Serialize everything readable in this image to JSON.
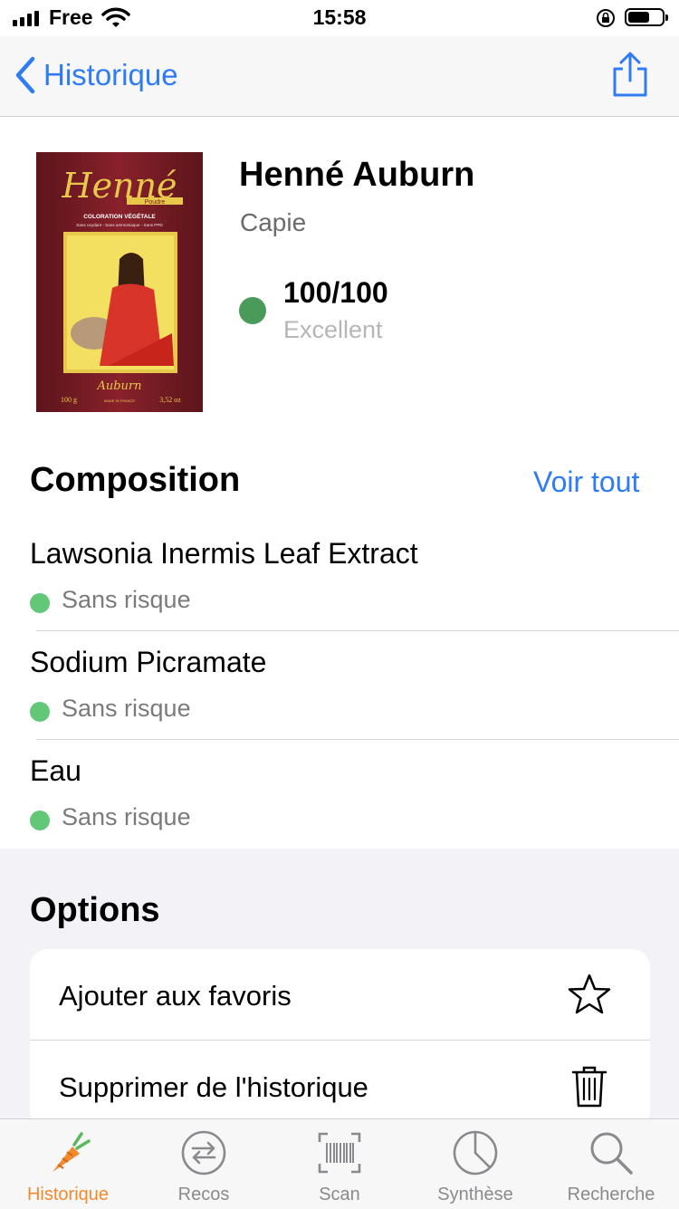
{
  "status_bar": {
    "carrier": "Free",
    "time": "15:58",
    "battery_level": 0.65
  },
  "nav": {
    "back_label": "Historique",
    "back_icon": "chevron-left-icon",
    "share_icon": "share-icon"
  },
  "product": {
    "name": "Henné Auburn",
    "brand": "Capie",
    "score": "100/100",
    "score_label": "Excellent",
    "score_color": "#4a9a5a",
    "image_texts": {
      "logo": "Henné",
      "sub": "Poudre",
      "line1": "COLORATION VÉGÉTALE",
      "line2": "Sans oxydant - Sans ammoniaque - Sans PPD",
      "variant": "Auburn",
      "weight": "100 g",
      "weight_oz": "3,52 oz",
      "origin": "MADE IN FRANCE"
    }
  },
  "composition": {
    "title": "Composition",
    "see_all": "Voir tout",
    "items": [
      {
        "name": "Lawsonia Inermis Leaf Extract",
        "risk": "Sans risque",
        "color": "#62c878"
      },
      {
        "name": "Sodium Picramate",
        "risk": "Sans risque",
        "color": "#62c878"
      },
      {
        "name": "Eau",
        "risk": "Sans risque",
        "color": "#62c878"
      }
    ]
  },
  "options": {
    "title": "Options",
    "items": [
      {
        "label": "Ajouter aux favoris",
        "icon": "star-icon"
      },
      {
        "label": "Supprimer de l'historique",
        "icon": "trash-icon"
      }
    ]
  },
  "tabs": [
    {
      "label": "Historique",
      "icon": "carrot-icon",
      "active": true
    },
    {
      "label": "Recos",
      "icon": "exchange-icon",
      "active": false
    },
    {
      "label": "Scan",
      "icon": "barcode-icon",
      "active": false
    },
    {
      "label": "Synthèse",
      "icon": "pie-chart-icon",
      "active": false
    },
    {
      "label": "Recherche",
      "icon": "search-icon",
      "active": false
    }
  ],
  "colors": {
    "accent": "#2f7bf5",
    "active_tab": "#f28a2e",
    "safe": "#62c878"
  }
}
